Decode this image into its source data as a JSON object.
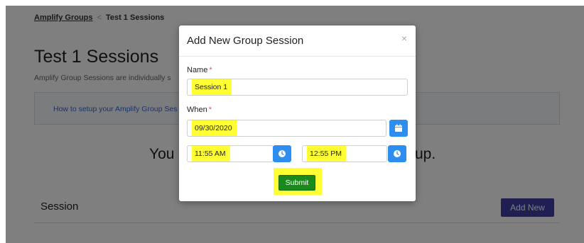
{
  "breadcrumb": {
    "parent": "Amplify Groups",
    "separator": "<",
    "current": "Test 1 Sessions"
  },
  "page": {
    "title": "Test 1 Sessions",
    "description": "Amplify Group Sessions are individually s",
    "info_link": "How to setup your Amplify Group Ses",
    "empty_message_start": "You",
    "empty_message_end": "up.",
    "section_label": "Session",
    "add_new_label": "Add New"
  },
  "modal": {
    "title": "Add New Group Session",
    "close_glyph": "×",
    "name_label": "Name",
    "required_mark": "*",
    "name_value": "Session 1",
    "when_label": "When",
    "date_value": "09/30/2020",
    "start_time_value": "11:55 AM",
    "end_time_value": "12:55 PM",
    "submit_label": "Submit"
  },
  "colors": {
    "highlight": "#ffff33",
    "icon_button": "#2d8ef0",
    "submit": "#1a8a1a",
    "add_new": "#3f3fa8"
  }
}
